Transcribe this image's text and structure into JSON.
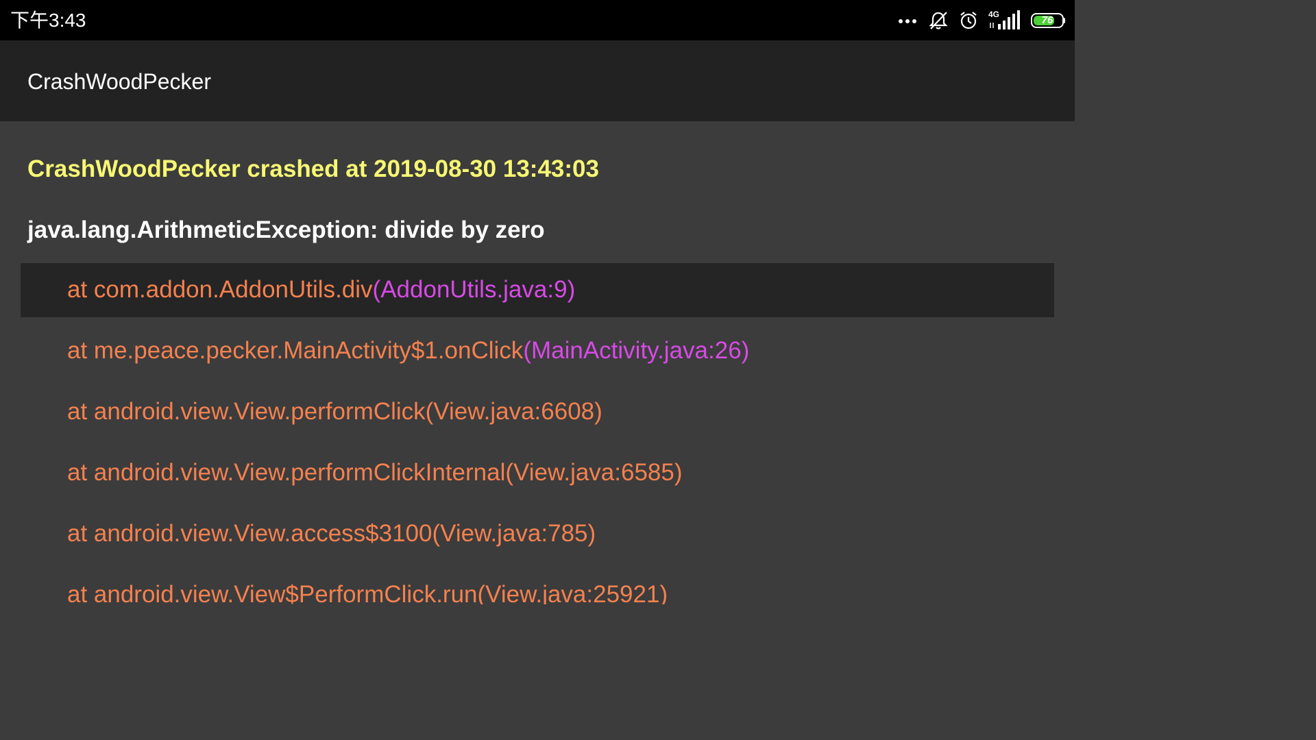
{
  "status_bar": {
    "time": "下午3:43",
    "icons": [
      "more-dots-icon",
      "mute-icon",
      "alarm-icon",
      "network-4g-icon",
      "signal-icon",
      "battery-icon"
    ],
    "network_label": "4G",
    "battery_level": "76",
    "battery_color": "#4cd137"
  },
  "app_bar": {
    "title": "CrashWoodPecker"
  },
  "crash": {
    "title": "CrashWoodPecker crashed at 2019-08-30 13:43:03",
    "exception": "java.lang.ArithmeticException: divide by zero",
    "trace": [
      {
        "method": "at com.addon.AddonUtils.div",
        "source": "(AddonUtils.java:9)",
        "highlight": true
      },
      {
        "method": "at me.peace.pecker.MainActivity$1.onClick",
        "source": "(MainActivity.java:26)",
        "highlight": false
      },
      {
        "method": "at android.view.View.performClick",
        "source": "(View.java:6608)",
        "highlight": false
      },
      {
        "method": "at android.view.View.performClickInternal",
        "source": "(View.java:6585)",
        "highlight": false
      },
      {
        "method": "at android.view.View.access$3100",
        "source": "(View.java:785)",
        "highlight": false
      },
      {
        "method": "at android.view.View$PerformClick.run",
        "source": "(View.java:25921)",
        "highlight": false
      }
    ],
    "colors": {
      "title": "#f7f774",
      "exception": "#ffffff",
      "method": "#f5814f",
      "app_source": "#d84ae6",
      "highlight_bg": "#252525"
    }
  }
}
